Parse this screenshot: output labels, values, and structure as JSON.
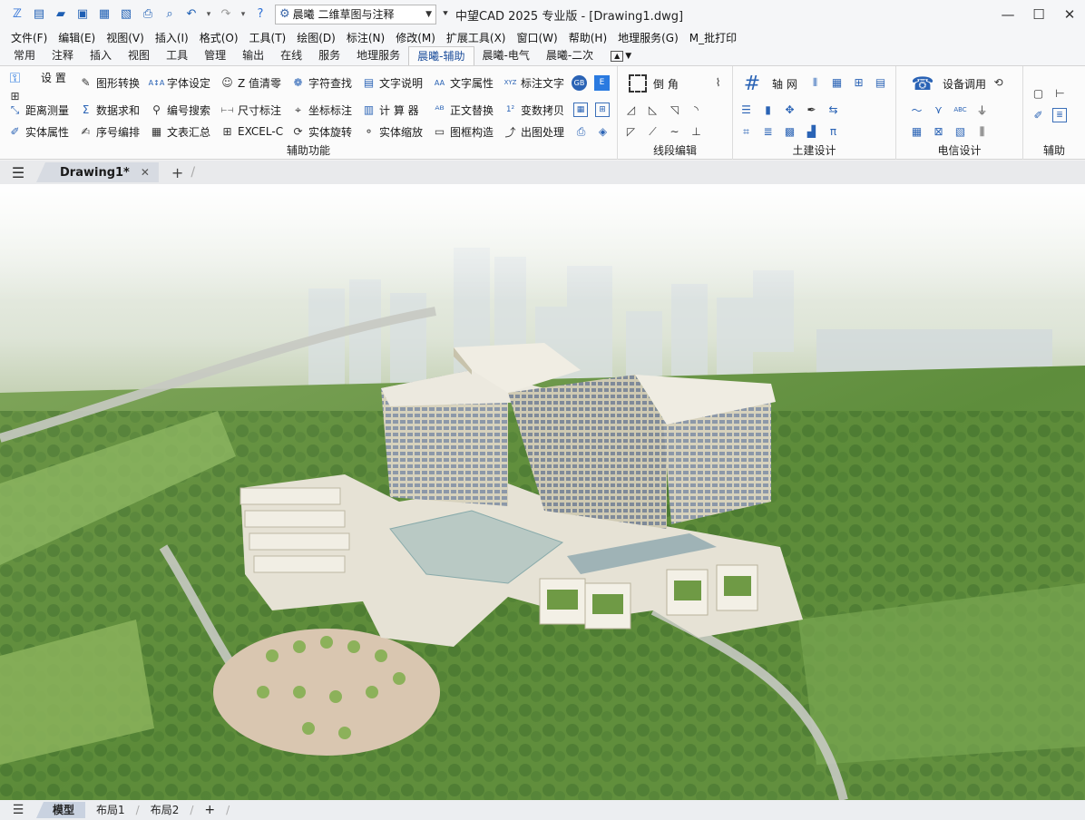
{
  "title_bar": {
    "workspace": "晨曦 二维草图与注释",
    "app_title": "中望CAD 2025 专业版 - [Drawing1.dwg]"
  },
  "menu": [
    "文件(F)",
    "编辑(E)",
    "视图(V)",
    "插入(I)",
    "格式(O)",
    "工具(T)",
    "绘图(D)",
    "标注(N)",
    "修改(M)",
    "扩展工具(X)",
    "窗口(W)",
    "帮助(H)",
    "地理服务(G)",
    "M_批打印"
  ],
  "ribbon_tabs": [
    "常用",
    "注释",
    "插入",
    "视图",
    "工具",
    "管理",
    "输出",
    "在线",
    "服务",
    "地理服务",
    "晨曦-辅助",
    "晨曦-电气",
    "晨曦-二次"
  ],
  "ribbon": {
    "aux": {
      "label": "辅助功能",
      "settings": "设 置",
      "graphic_convert": "图形转换",
      "font_settings": "字体设定",
      "z_zero": "Z 值清零",
      "char_find": "字符查找",
      "text_desc": "文字说明",
      "text_attr": "文字属性",
      "dim_text": "标注文字",
      "distance": "距离测量",
      "sum": "数据求和",
      "num_search": "编号搜索",
      "dim_size": "尺寸标注",
      "coord_dim": "坐标标注",
      "calculator": "计 算 器",
      "text_replace": "正文替换",
      "var_copy": "变数拷贝",
      "entity_attr": "实体属性",
      "seq_edit": "序号编排",
      "text_summary": "文表汇总",
      "excel": "EXCEL-C",
      "entity_rotate": "实体旋转",
      "entity_scale": "实体缩放",
      "frame_build": "图框构造",
      "output_proc": "出图处理"
    },
    "line": {
      "label": "线段编辑",
      "chamfer": "倒 角"
    },
    "civil": {
      "label": "土建设计",
      "axis": "轴 网"
    },
    "telecom": {
      "label": "电信设计",
      "device": "设备调用"
    },
    "aid": {
      "label": "辅助"
    }
  },
  "doc_tab": {
    "name": "Drawing1*"
  },
  "layout_tabs": [
    "模型",
    "布局1",
    "布局2"
  ]
}
